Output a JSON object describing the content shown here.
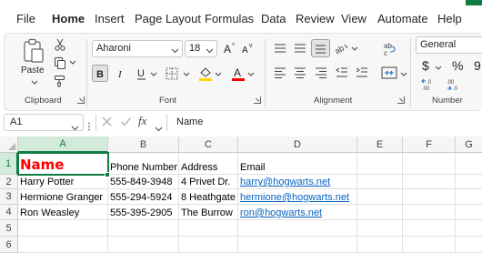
{
  "tabs": [
    "File",
    "Home",
    "Insert",
    "Page Layout",
    "Formulas",
    "Data",
    "Review",
    "View",
    "Automate",
    "Help"
  ],
  "ribbon": {
    "clipboard": {
      "label": "Clipboard",
      "paste_label": "Paste"
    },
    "font": {
      "label": "Font",
      "font_name": "Aharoni",
      "font_size": "18"
    },
    "alignment": {
      "label": "Alignment"
    },
    "number": {
      "label": "Number",
      "format": "General"
    }
  },
  "formula_bar": {
    "name_box": "A1",
    "fx": "fx",
    "content": "Name"
  },
  "grid": {
    "columns": [
      "A",
      "B",
      "C",
      "D",
      "E",
      "F",
      "G"
    ],
    "rows": [
      "1",
      "2",
      "3",
      "4",
      "5",
      "6"
    ],
    "cells": {
      "r1": [
        "Name",
        "Phone Number",
        "Address",
        "Email"
      ],
      "r2": [
        "Harry Potter",
        "555-849-3948",
        "4 Privet Dr.",
        "harry@hogwarts.net"
      ],
      "r3": [
        "Hermione Granger",
        "555-294-5924",
        "8 Heathgate",
        "hermione@hogwarts.net"
      ],
      "r4": [
        "Ron Weasley",
        "555-395-2905",
        "The Burrow",
        "ron@hogwarts.net"
      ]
    }
  },
  "colors": {
    "accent": "#107c41",
    "name_red": "#ff0000",
    "link": "#0563c1"
  }
}
